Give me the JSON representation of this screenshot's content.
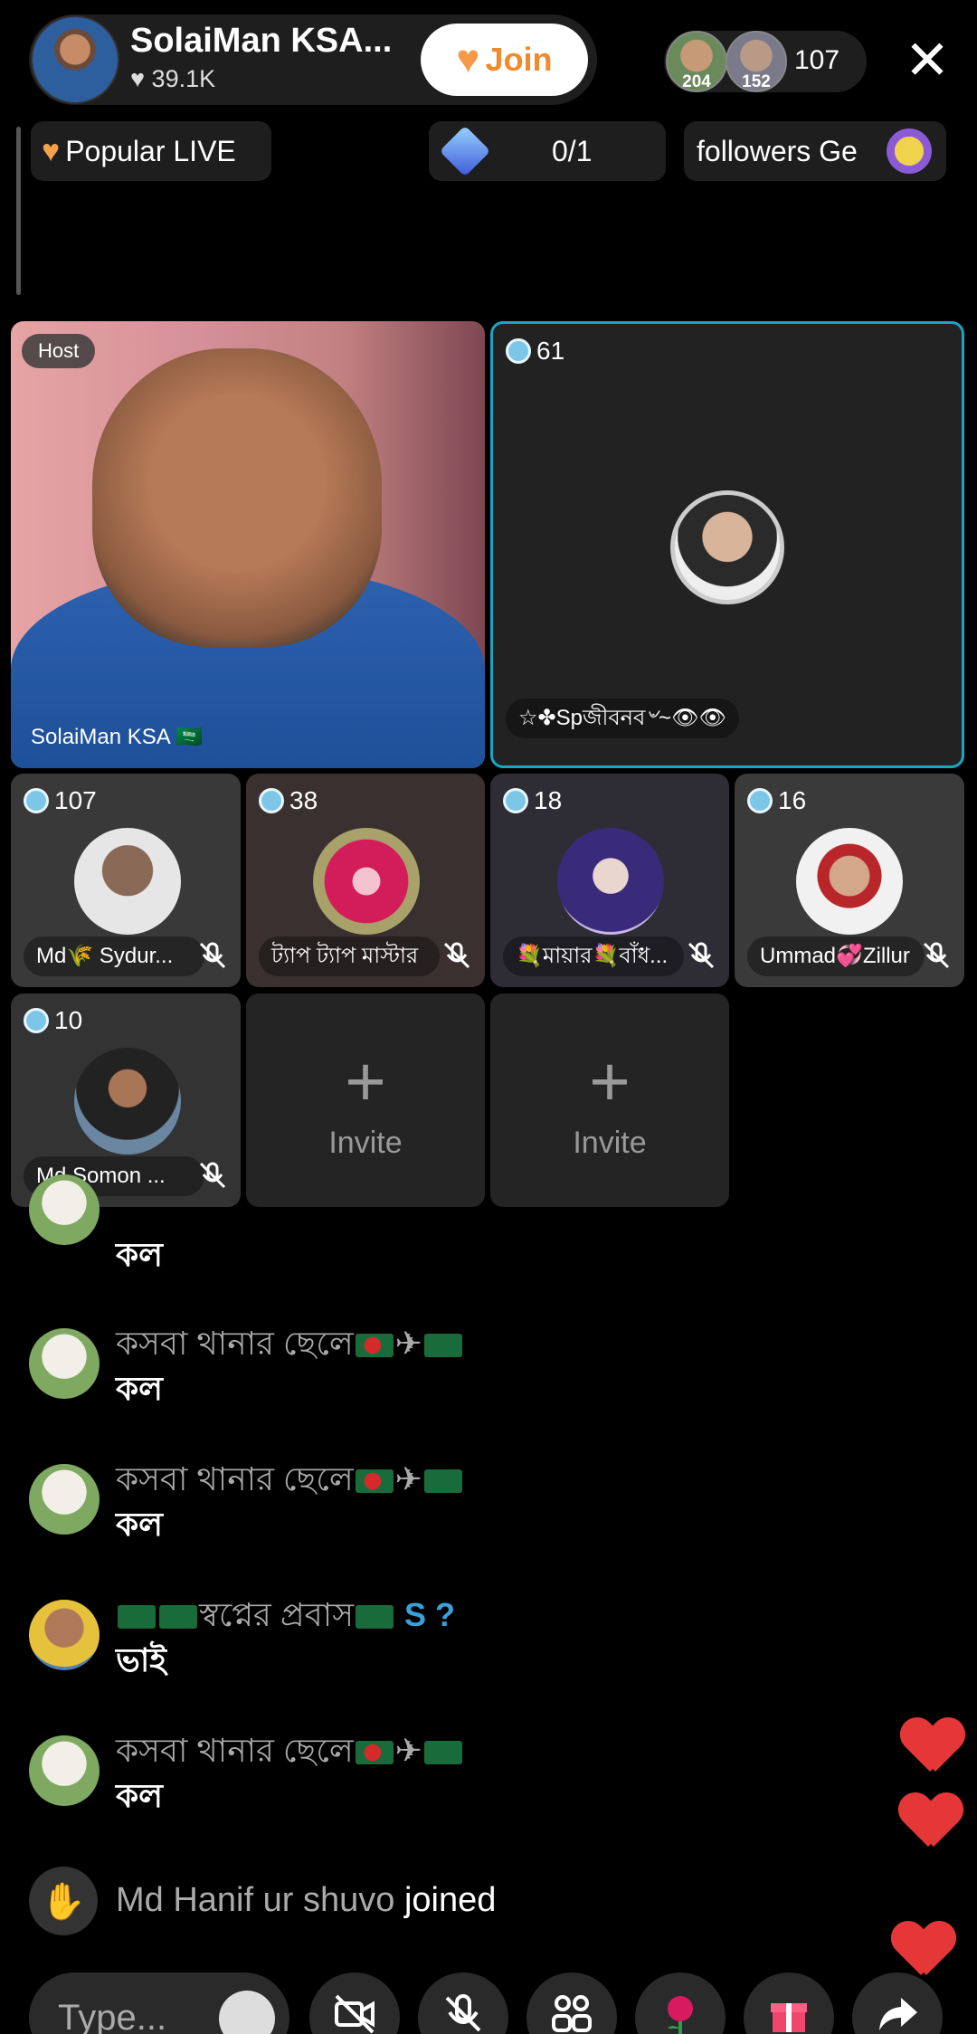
{
  "header": {
    "host_name": "SolaiMan KSA...",
    "likes": "39.1K",
    "join_label": "Join",
    "viewer_avatars": [
      {
        "count": "204",
        "color": "#6b8a5c"
      },
      {
        "count": "152",
        "color": "#7a7a8a"
      }
    ],
    "viewer_count": "107"
  },
  "chips": {
    "popular": "Popular LIVE",
    "task": "0/1",
    "followers": "followers Ge"
  },
  "host_tile": {
    "badge": "Host",
    "name": "SolaiMan KSA 🇸🇦"
  },
  "seats": [
    {
      "count": "61",
      "name": "☆✤Spজীবনব৺~👁👁"
    },
    {
      "count": "107",
      "name": "Md🌾 Sydur..."
    },
    {
      "count": "38",
      "name": "ট্যাপ ট্যাপ মাস্টার"
    },
    {
      "count": "18",
      "name": "💐মায়ার💐বাঁধ..."
    },
    {
      "count": "16",
      "name": "Ummad💞Zillur"
    },
    {
      "count": "10",
      "name": "Md Somon ..."
    }
  ],
  "invite_label": "Invite",
  "chat": [
    {
      "user": "",
      "text": "কল"
    },
    {
      "user": "কসবা থানার ছেলে",
      "text": "কল"
    },
    {
      "user": "কসবা থানার ছেলে",
      "text": "কল"
    },
    {
      "user": "স্বপ্নের প্রবাস",
      "suffix": "S ?",
      "text": "ভাই"
    },
    {
      "user": "কসবা থানার ছেলে",
      "text": "কল"
    }
  ],
  "joined": {
    "user": "Md Hanif ur shuvo",
    "action": "joined"
  },
  "input": {
    "placeholder": "Type..."
  },
  "toolbar_icons": [
    "camera-off-icon",
    "mic-off-icon",
    "seats-icon",
    "rose-icon",
    "gift-icon",
    "share-icon"
  ],
  "colors": {
    "accent_join": "#f08a2c",
    "seat_border": "#1ea3c3",
    "heart": "#e53737"
  }
}
